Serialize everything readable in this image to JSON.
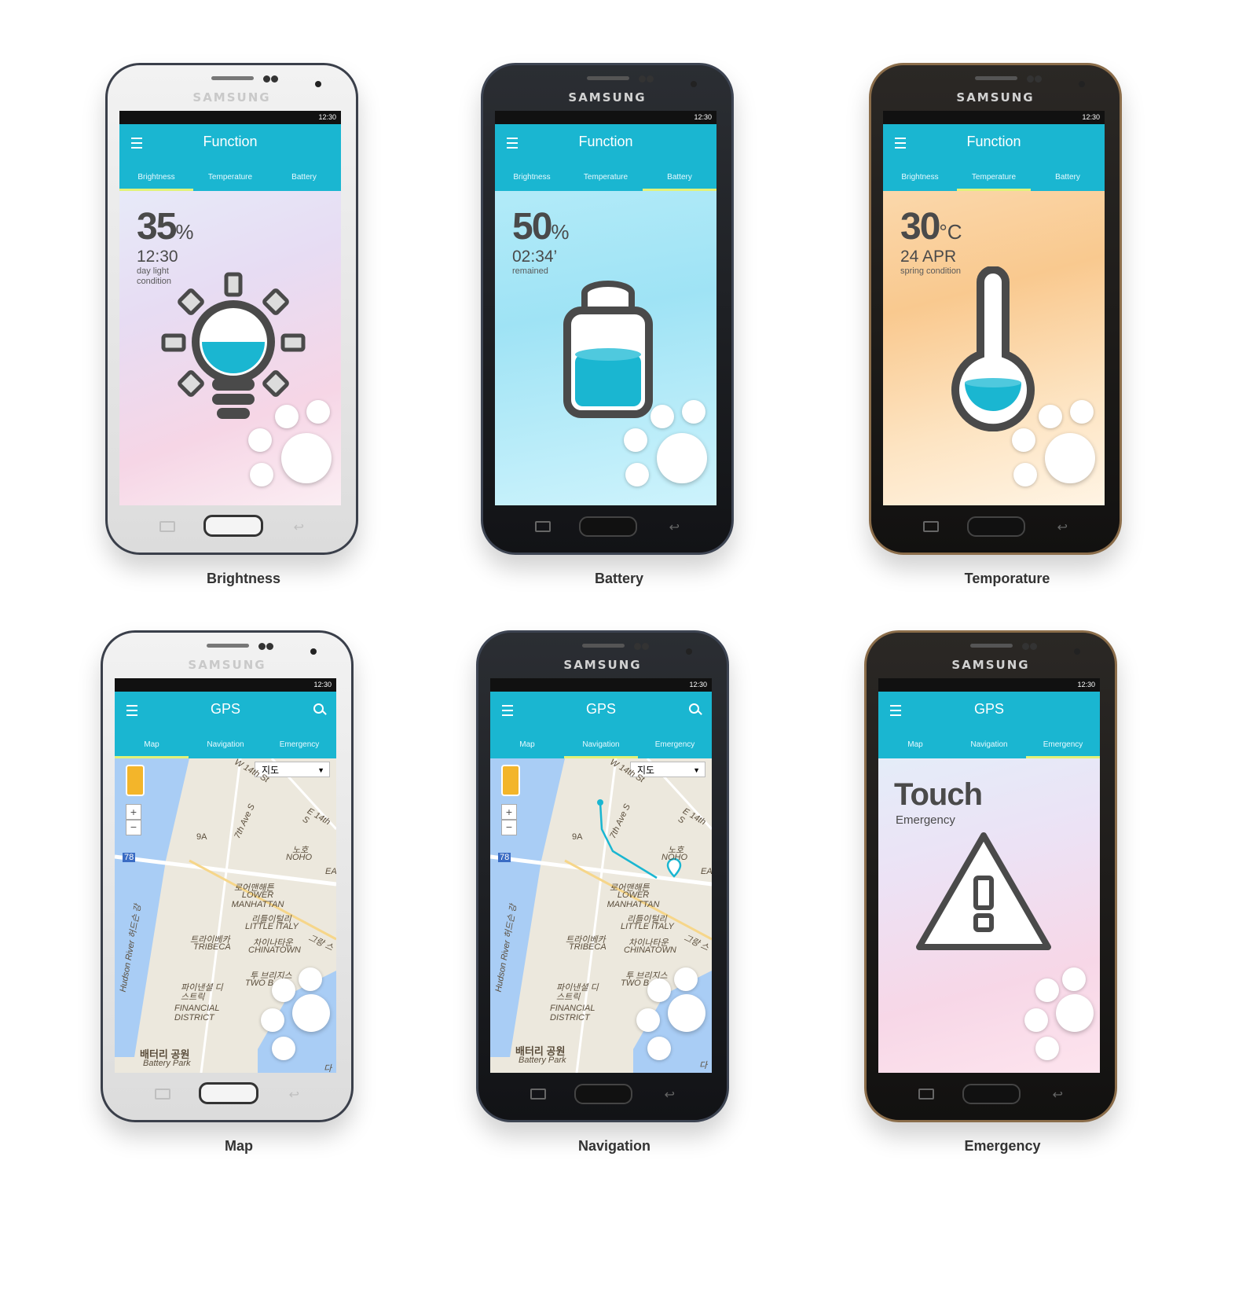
{
  "brand": "SAMSUNG",
  "status_time": "12:30",
  "colors": {
    "appbar": "#1ab6d1",
    "tab_indicator": "#e2f279",
    "icon_gray": "#4a4a4a",
    "accent": "#1ab6d1"
  },
  "function_tabs": [
    "Brightness",
    "Temperature",
    "Battery"
  ],
  "gps_tabs": [
    "Map",
    "Navigation",
    "Emergency"
  ],
  "screens": [
    {
      "caption": "Brightness",
      "title": "Function",
      "value": "35",
      "unit": "%",
      "sub": "12:30",
      "note": "day light condition",
      "active_tab": "Brightness",
      "icon": "lightbulb-icon"
    },
    {
      "caption": "Battery",
      "title": "Function",
      "value": "50",
      "unit": "%",
      "sub": "02:34’",
      "note": "remained",
      "active_tab": "Battery",
      "icon": "battery-icon"
    },
    {
      "caption": "Temporature",
      "title": "Function",
      "value": "30",
      "unit": "°C",
      "sub": "24 APR",
      "note": "spring condition",
      "active_tab": "Temperature",
      "icon": "thermometer-icon"
    },
    {
      "caption": "Map",
      "title": "GPS",
      "active_tab": "Map",
      "map_type": "지도"
    },
    {
      "caption": "Navigation",
      "title": "GPS",
      "active_tab": "Navigation",
      "map_type": "지도"
    },
    {
      "caption": "Emergency",
      "title": "GPS",
      "active_tab": "Emergency",
      "headline": "Touch",
      "subline": "Emergency",
      "icon": "warning-icon"
    }
  ],
  "map_labels": [
    "W 14th St",
    "E 14th S",
    "7th Ave S",
    "노호",
    "NOHO",
    "로어맨해튼",
    "LOWER MANHATTAN",
    "리틀이털리",
    "LITTLE ITALY",
    "트라이베카",
    "TRIBECA",
    "차이나타운",
    "CHINATOWN",
    "파이낸셜 디스트릭",
    "FINANCIAL DISTRICT",
    "투 브리지스",
    "TWO B",
    "배터리 공원",
    "Battery Park",
    "Hudson River 허드슨 강",
    "9A",
    "78",
    "그랑 스",
    "EA",
    "다"
  ]
}
